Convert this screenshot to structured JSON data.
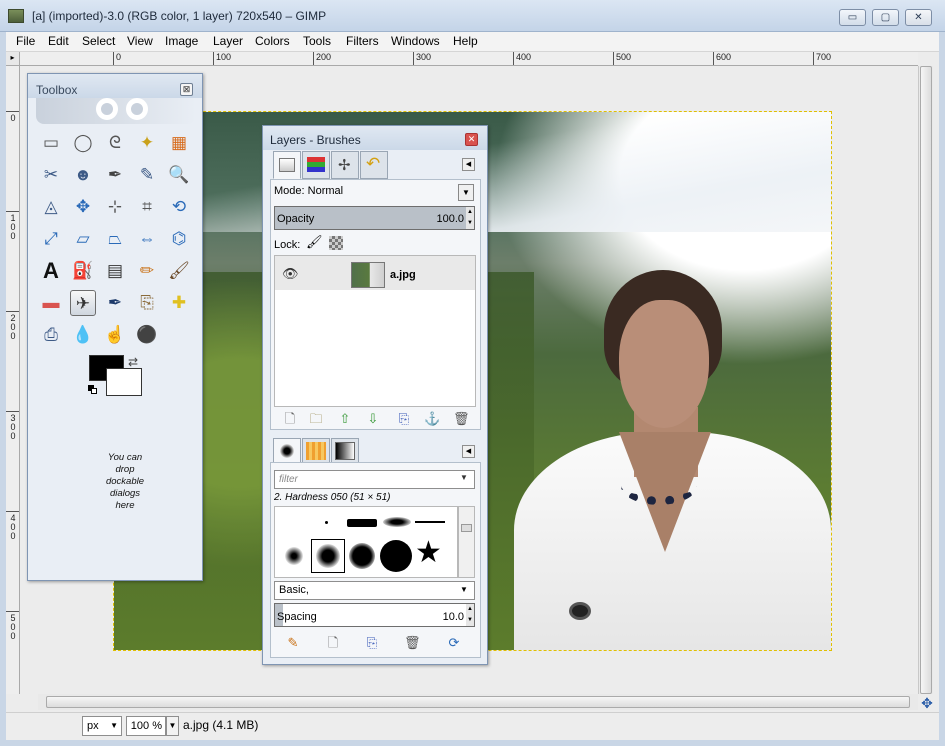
{
  "window": {
    "title": "[a] (imported)-3.0 (RGB color, 1 layer) 720x540 – GIMP",
    "minimize": "▭",
    "maximize": "▢",
    "close": "✕"
  },
  "menubar": [
    "File",
    "Edit",
    "Select",
    "View",
    "Image",
    "Layer",
    "Colors",
    "Tools",
    "Filters",
    "Windows",
    "Help"
  ],
  "rulers": {
    "horizontal": [
      "0",
      "100",
      "200",
      "300",
      "400",
      "500",
      "600",
      "700"
    ],
    "vertical": [
      "0",
      "100",
      "200",
      "300",
      "400",
      "500"
    ]
  },
  "toolbox": {
    "title": "Toolbox",
    "close": "⊠",
    "drop_hint": "You can drop dockable dialogs here",
    "tools": [
      {
        "name": "rect-select-tool-icon",
        "glyph": "▭",
        "color": "#555555"
      },
      {
        "name": "ellipse-select-tool-icon",
        "glyph": "◯",
        "color": "#555555"
      },
      {
        "name": "free-select-tool-icon",
        "glyph": "ᘓ",
        "color": "#555555"
      },
      {
        "name": "fuzzy-select-tool-icon",
        "glyph": "✦",
        "color": "#c9a11a"
      },
      {
        "name": "select-by-color-tool-icon",
        "glyph": "▦",
        "color": "#d76b1c"
      },
      {
        "name": "scissors-tool-icon",
        "glyph": "✂",
        "color": "#3d5a86"
      },
      {
        "name": "foreground-select-tool-icon",
        "glyph": "☻",
        "color": "#3d5a86"
      },
      {
        "name": "paths-tool-icon",
        "glyph": "✒",
        "color": "#444444"
      },
      {
        "name": "color-picker-tool-icon",
        "glyph": "✎",
        "color": "#3d5a86"
      },
      {
        "name": "zoom-tool-icon",
        "glyph": "🔍",
        "color": "#3d5a86"
      },
      {
        "name": "measure-tool-icon",
        "glyph": "◬",
        "color": "#3d5a86"
      },
      {
        "name": "move-tool-icon",
        "glyph": "✥",
        "color": "#2a6ab8"
      },
      {
        "name": "align-tool-icon",
        "glyph": "⊹",
        "color": "#555555"
      },
      {
        "name": "crop-tool-icon",
        "glyph": "⌗",
        "color": "#555555"
      },
      {
        "name": "rotate-tool-icon",
        "glyph": "⟲",
        "color": "#2a6ab8"
      },
      {
        "name": "scale-tool-icon",
        "glyph": "⤢",
        "color": "#2a6ab8"
      },
      {
        "name": "shear-tool-icon",
        "glyph": "▱",
        "color": "#2a6ab8"
      },
      {
        "name": "perspective-tool-icon",
        "glyph": "⏢",
        "color": "#2a6ab8"
      },
      {
        "name": "flip-tool-icon",
        "glyph": "⇔",
        "color": "#2a6ab8"
      },
      {
        "name": "cage-tool-icon",
        "glyph": "⌬",
        "color": "#2a6ab8"
      },
      {
        "name": "text-tool-icon",
        "glyph": "A",
        "color": "#111111"
      },
      {
        "name": "bucket-fill-tool-icon",
        "glyph": "⛽",
        "color": "#555555"
      },
      {
        "name": "blend-tool-icon",
        "glyph": "▤",
        "color": "#333333"
      },
      {
        "name": "pencil-tool-icon",
        "glyph": "✏",
        "color": "#c9731a"
      },
      {
        "name": "paintbrush-tool-icon",
        "glyph": "🖌",
        "color": "#6b4a2a"
      },
      {
        "name": "eraser-tool-icon",
        "glyph": "▬",
        "color": "#d9534f"
      },
      {
        "name": "airbrush-tool-icon",
        "glyph": "✈",
        "color": "#333333"
      },
      {
        "name": "ink-tool-icon",
        "glyph": "✒",
        "color": "#1d3a6a"
      },
      {
        "name": "clone-tool-icon",
        "glyph": "⎘",
        "color": "#8a6a3a"
      },
      {
        "name": "heal-tool-icon",
        "glyph": "✚",
        "color": "#e0c020"
      },
      {
        "name": "perspective-clone-tool-icon",
        "glyph": "⎙",
        "color": "#3d5a86"
      },
      {
        "name": "blur-sharpen-tool-icon",
        "glyph": "💧",
        "color": "#2a6ab8"
      },
      {
        "name": "smudge-tool-icon",
        "glyph": "☝",
        "color": "#c9731a"
      },
      {
        "name": "dodge-burn-tool-icon",
        "glyph": "⚫",
        "color": "#333333"
      }
    ]
  },
  "layers_dialog": {
    "title": "Layers - Brushes",
    "close": "✕",
    "tabs": [
      "layers-tab-icon",
      "channels-tab-icon",
      "paths-tab-icon",
      "undo-tab-icon"
    ],
    "mode_label": "Mode:",
    "mode_value": "Normal",
    "opacity_label": "Opacity",
    "opacity_value": "100.0",
    "lock_label": "Lock:",
    "layer_name": "a.jpg",
    "footer_buttons": [
      "new-layer-icon",
      "new-layer-group-icon",
      "raise-layer-icon",
      "lower-layer-icon",
      "duplicate-layer-icon",
      "anchor-layer-icon",
      "delete-layer-icon"
    ]
  },
  "brushes": {
    "tabs": [
      "brushes-tab-icon",
      "patterns-tab-icon",
      "gradients-tab-icon"
    ],
    "filter_placeholder": "filter",
    "brush_name": "2. Hardness 050 (51 × 51)",
    "preset": "Basic,",
    "spacing_label": "Spacing",
    "spacing_value": "10.0",
    "footer_buttons": [
      "edit-brush-icon",
      "new-brush-icon",
      "duplicate-brush-icon",
      "delete-brush-icon",
      "refresh-brushes-icon"
    ]
  },
  "statusbar": {
    "unit": "px",
    "zoom": "100 %",
    "info": "a.jpg (4.1 MB)"
  }
}
